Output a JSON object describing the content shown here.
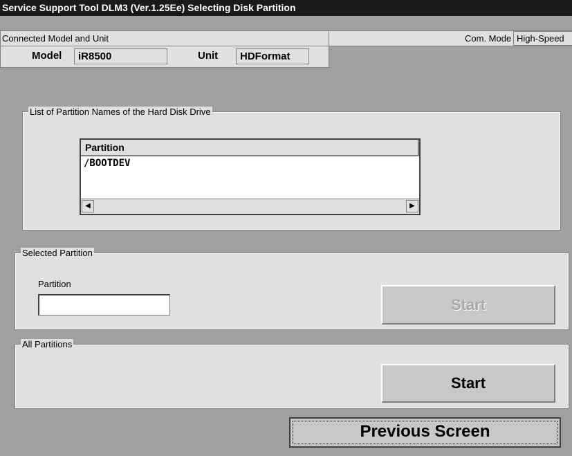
{
  "window": {
    "title": "Service Support Tool DLM3 (Ver.1.25Ee) Selecting Disk Partition"
  },
  "connection": {
    "section_label": "Connected Model and Unit",
    "com_mode_label": "Com. Mode",
    "com_mode_value": "High-Speed",
    "model_label": "Model",
    "model_value": "iR8500",
    "unit_label": "Unit",
    "unit_value": "HDFormat"
  },
  "partition_list": {
    "group_title": "List of Partition Names of the Hard Disk Drive",
    "column_header": "Partition",
    "rows": [
      "/BOOTDEV"
    ]
  },
  "selected_partition": {
    "group_title": "Selected Partition",
    "field_label": "Partition",
    "field_value": "",
    "start_label": "Start"
  },
  "all_partitions": {
    "group_title": "All Partitions",
    "start_label": "Start"
  },
  "footer": {
    "previous_label": "Previous Screen"
  }
}
